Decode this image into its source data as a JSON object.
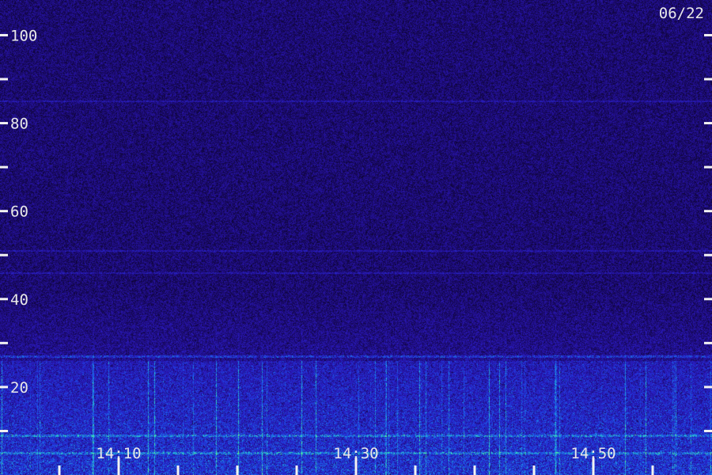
{
  "date_label": "06/22",
  "chart_data": {
    "type": "heatmap",
    "title": "",
    "xlabel": "",
    "ylabel": "",
    "y_range": [
      0,
      108
    ],
    "y_major_ticks": [
      20,
      40,
      60,
      80,
      100
    ],
    "y_tick_labels": [
      "20",
      "40",
      "60",
      "80",
      "100"
    ],
    "y_minor_ticks": [
      10,
      30,
      50,
      70,
      90
    ],
    "x_range_minutes": [
      0,
      60
    ],
    "x_labeled_ticks": [
      {
        "time": "14:10",
        "minute": 10
      },
      {
        "time": "14:30",
        "minute": 30
      },
      {
        "time": "14:50",
        "minute": 50
      }
    ],
    "x_tick_every_minutes": 5,
    "colormap": [
      "#08021a",
      "#1b0a6e",
      "#2a18b8",
      "#1f3de0",
      "#1b86e6",
      "#2fe0c0",
      "#6cff7a"
    ],
    "background_level": 0.25,
    "activity_band_top_value": 26,
    "bright_lines_value": [
      27,
      9,
      5
    ],
    "faint_lines_value": [
      85,
      46,
      51
    ]
  }
}
